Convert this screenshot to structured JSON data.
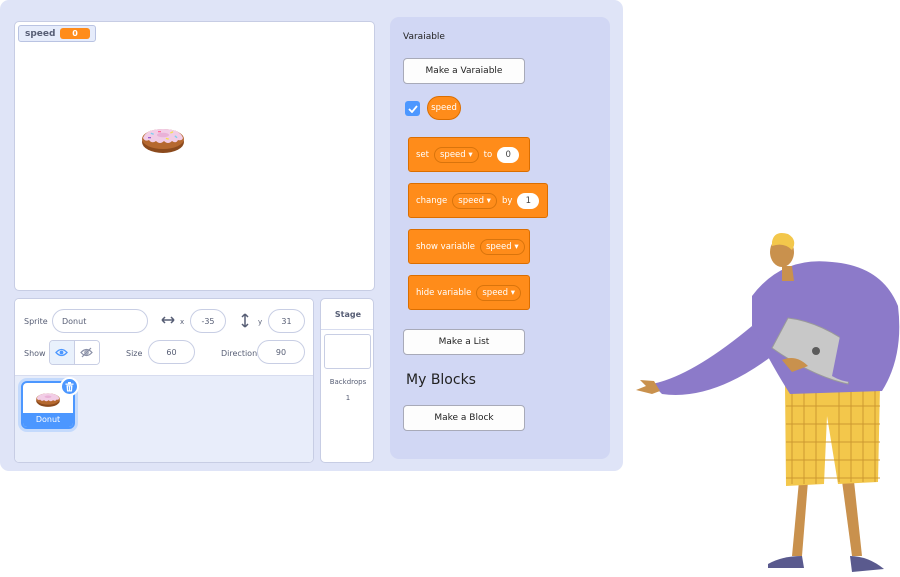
{
  "stage": {
    "monitor": {
      "label": "speed",
      "value": "0"
    }
  },
  "sprite_info": {
    "sprite_label": "Sprite",
    "sprite_name": "Donut",
    "x_label": "x",
    "x_value": "-35",
    "y_label": "y",
    "y_value": "31",
    "show_label": "Show",
    "size_label": "Size",
    "size_value": "60",
    "direction_label": "Direction",
    "direction_value": "90"
  },
  "sprite_list": {
    "items": [
      {
        "name": "Donut"
      }
    ]
  },
  "stage_target": {
    "title": "Stage",
    "backdrops_label": "Backdrops",
    "backdrops_count": "1"
  },
  "palette": {
    "section_title": "Varaiable",
    "make_variable_label": "Make a Varaiable",
    "variable_reporter": "speed",
    "variable_checked": true,
    "blocks": {
      "set": {
        "word": "set",
        "var": "speed ▾",
        "to": "to",
        "value": "0"
      },
      "change": {
        "word": "change",
        "var": "speed ▾",
        "by": "by",
        "value": "1"
      },
      "show": {
        "word": "show variable",
        "var": "speed ▾"
      },
      "hide": {
        "word": "hide variable",
        "var": "speed ▾"
      }
    },
    "make_list_label": "Make a List",
    "my_blocks_title": "My Blocks",
    "make_block_label": "Make a Block"
  },
  "colors": {
    "variables_orange": "#ff8c1a",
    "accent_blue": "#4c97ff",
    "palette_bg": "#d1d7f4",
    "frame_bg": "#dfe4f7"
  },
  "icons": [
    "donut-icon",
    "eye-icon",
    "eye-slash-icon",
    "trash-icon",
    "horizontal-arrows-icon",
    "vertical-arrows-icon",
    "checkbox-checked-icon"
  ]
}
